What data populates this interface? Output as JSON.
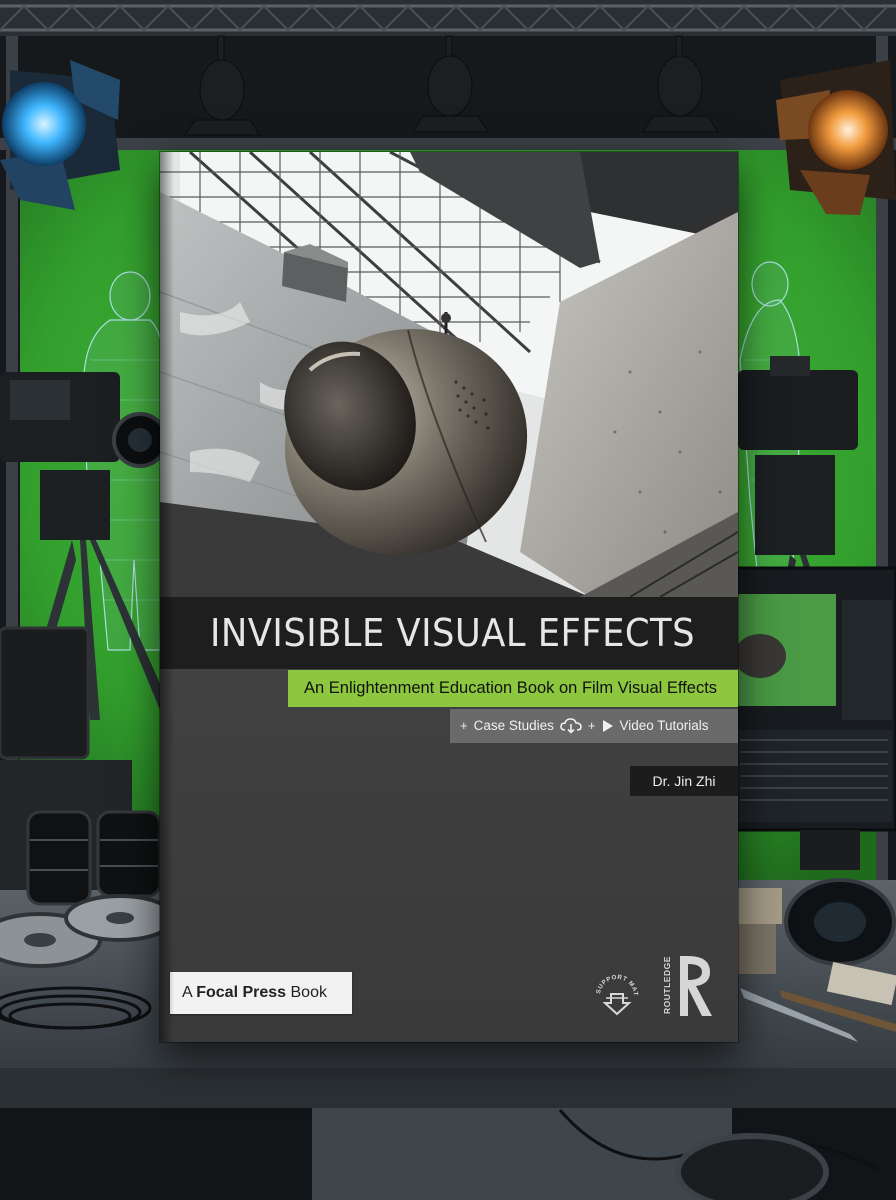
{
  "book": {
    "title": "INVISIBLE VISUAL EFFECTS",
    "subtitle": "An Enlightenment Education Book on Film Visual Effects",
    "features": {
      "plus": "+",
      "case_studies": "Case Studies",
      "video_tutorials": "Video Tutorials",
      "cloud_icon": "cloud-download-icon",
      "play_icon": "play-icon"
    },
    "author": "Dr. Jin Zhi",
    "publisher": {
      "prefix": "A ",
      "name": "Focal Press",
      "suffix": " Book"
    },
    "support_badge": "SUPPORT MATERIAL",
    "imprint": "ROUTLEDGE"
  },
  "colors": {
    "accent_green": "#8dc63f",
    "cover_gray": "#444444",
    "title_band": "#1e1e1e",
    "green_screen": "#3aa233"
  }
}
